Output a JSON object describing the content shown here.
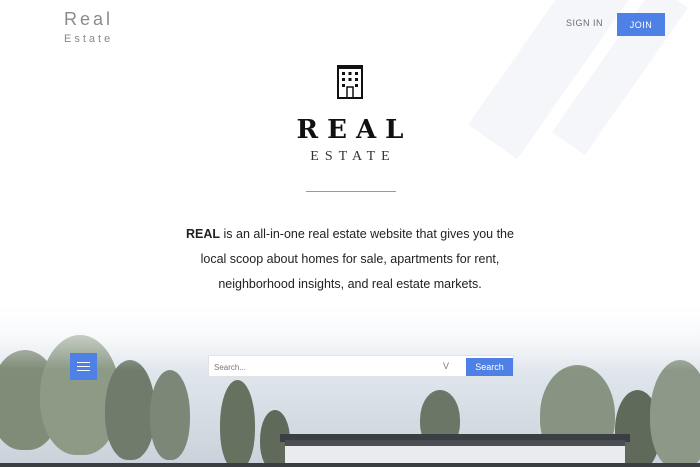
{
  "header": {
    "brand_line1": "Real",
    "brand_line2": "Estate",
    "signin_label": "SIGN IN",
    "join_label": "JOIN"
  },
  "logo": {
    "icon": "building-icon",
    "title": "REAL",
    "subtitle": "ESTATE"
  },
  "description": {
    "lead": "REAL",
    "text": " is an all-in-one real estate website that gives you the local scoop about homes for sale, apartments for rent, neighborhood insights, and real estate markets."
  },
  "search": {
    "placeholder": "Search...",
    "dropdown_glyph": "V",
    "button_label": "Search"
  },
  "menu": {
    "icon": "hamburger-menu-icon"
  },
  "colors": {
    "accent": "#4e80e6",
    "text": "#222222",
    "brand": "#8a8a8a"
  }
}
